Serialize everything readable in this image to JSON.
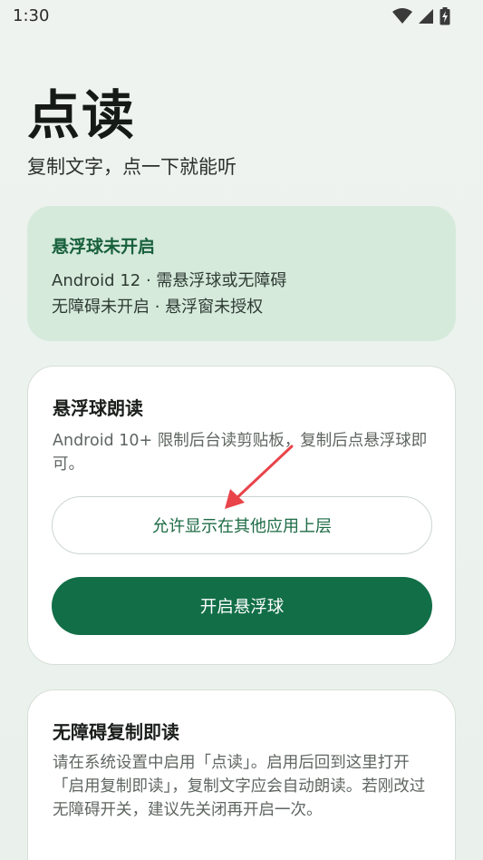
{
  "status_bar": {
    "time": "1:30",
    "icons": [
      "wifi-icon",
      "cellular-signal-icon",
      "battery-charging-icon"
    ]
  },
  "header": {
    "title": "点读",
    "subtitle": "复制文字，点一下就能听"
  },
  "status_card": {
    "title": "悬浮球未开启",
    "line1": "Android 12 · 需悬浮球或无障碍",
    "line2": "无障碍未开启 · 悬浮窗未授权"
  },
  "floating_card": {
    "title": "悬浮球朗读",
    "description": "Android 10+ 限制后台读剪贴板，复制后点悬浮球即可。",
    "overlay_permission_label": "允许显示在其他应用上层",
    "enable_label": "开启悬浮球"
  },
  "accessibility_card": {
    "title": "无障碍复制即读",
    "description": "请在系统设置中启用「点读」。启用后回到这里打开「启用复制即读」，复制文字应会自动朗读。若刚改过无障碍开关，建议先关闭再开启一次。"
  },
  "colors": {
    "accent": "#126e47",
    "status_card_bg": "#d6eadc",
    "status_title": "#18603c",
    "annotation_arrow": "#e8444a"
  }
}
